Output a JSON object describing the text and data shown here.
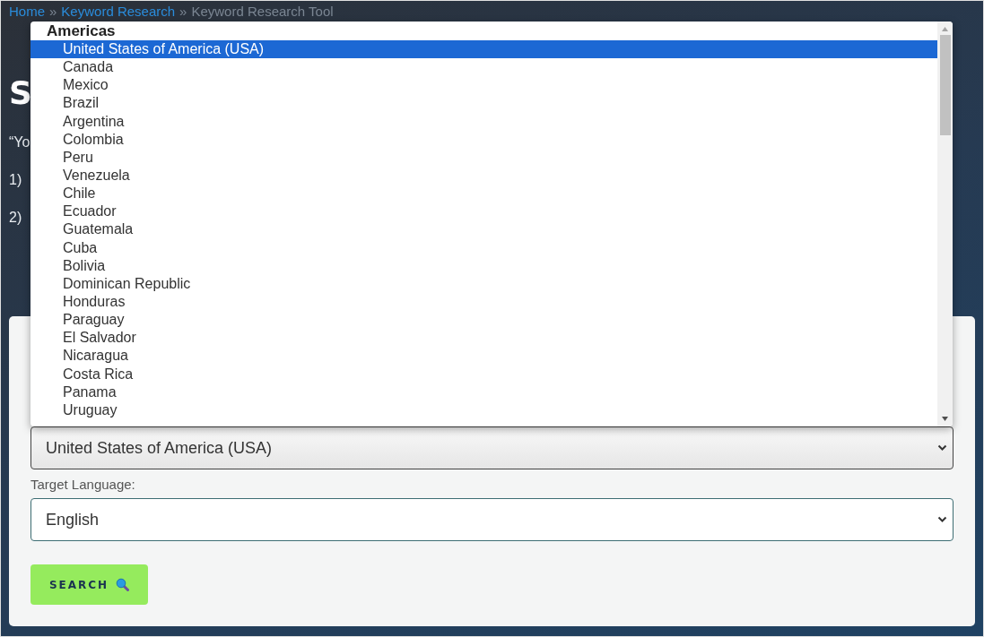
{
  "breadcrumb": [
    {
      "label": "Home",
      "kind": "link"
    },
    {
      "label": "»",
      "kind": "separator"
    },
    {
      "label": "Keyword Research",
      "kind": "link"
    },
    {
      "label": "»",
      "kind": "separator"
    },
    {
      "label": "Keyword Research Tool",
      "kind": "current"
    }
  ],
  "heading": "S",
  "intro": "“Yo",
  "steps": [
    "1)",
    "2)"
  ],
  "form": {
    "country_select": {
      "value": "United States of America (USA)"
    },
    "language_label": "Target Language:",
    "language_select": {
      "value": "English"
    },
    "search_button": {
      "label": "SEARCH"
    }
  },
  "dropdown": {
    "group": "Americas",
    "options": [
      {
        "label": "United States of America (USA)",
        "selected": true
      },
      {
        "label": "Canada",
        "selected": false
      },
      {
        "label": "Mexico",
        "selected": false
      },
      {
        "label": "Brazil",
        "selected": false
      },
      {
        "label": "Argentina",
        "selected": false
      },
      {
        "label": "Colombia",
        "selected": false
      },
      {
        "label": "Peru",
        "selected": false
      },
      {
        "label": "Venezuela",
        "selected": false
      },
      {
        "label": "Chile",
        "selected": false
      },
      {
        "label": "Ecuador",
        "selected": false
      },
      {
        "label": "Guatemala",
        "selected": false
      },
      {
        "label": "Cuba",
        "selected": false
      },
      {
        "label": "Bolivia",
        "selected": false
      },
      {
        "label": "Dominican Republic",
        "selected": false
      },
      {
        "label": "Honduras",
        "selected": false
      },
      {
        "label": "Paraguay",
        "selected": false
      },
      {
        "label": "El Salvador",
        "selected": false
      },
      {
        "label": "Nicaragua",
        "selected": false
      },
      {
        "label": "Costa Rica",
        "selected": false
      },
      {
        "label": "Panama",
        "selected": false
      },
      {
        "label": "Uruguay",
        "selected": false
      }
    ]
  }
}
